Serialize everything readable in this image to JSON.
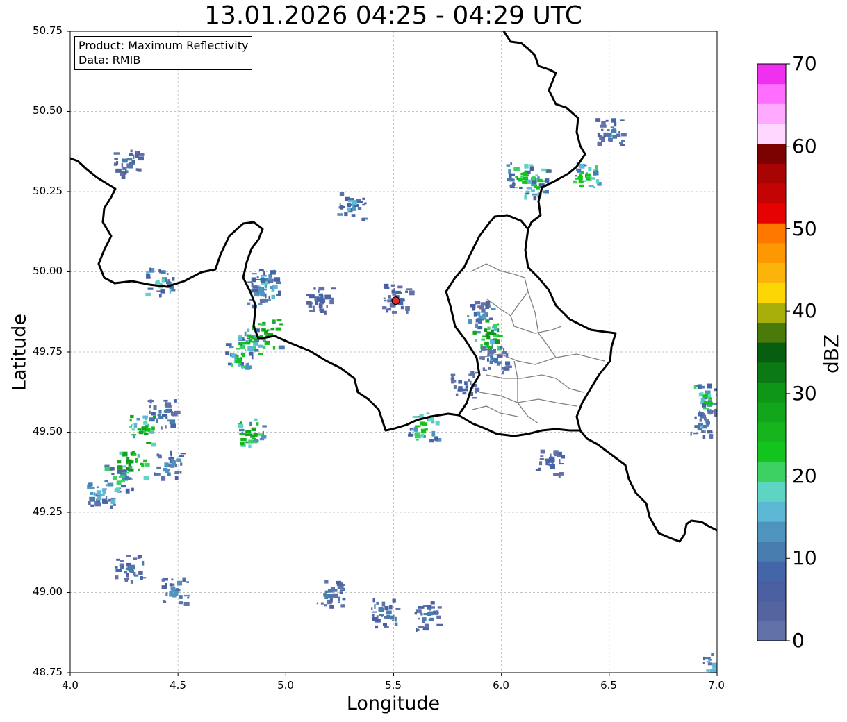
{
  "title": "13.01.2026 04:25 - 04:29 UTC",
  "info_box": {
    "product": "Product: Maximum Reflectivity",
    "data": "Data: RMIB"
  },
  "chart_data": {
    "type": "heatmap",
    "title": "13.01.2026 04:25 - 04:29 UTC",
    "xlabel": "Longitude",
    "ylabel": "Latitude",
    "xlim": [
      4.0,
      7.0
    ],
    "ylim": [
      48.75,
      50.75
    ],
    "x_ticks": [
      "4.0",
      "4.5",
      "5.0",
      "5.5",
      "6.0",
      "6.5",
      "7.0"
    ],
    "y_ticks": [
      "48.75",
      "49.00",
      "49.25",
      "49.50",
      "49.75",
      "50.00",
      "50.25",
      "50.50",
      "50.75"
    ],
    "grid": true,
    "radar_site": {
      "lon": 5.51,
      "lat": 49.91
    },
    "colorbar": {
      "label": "dBZ",
      "min": 0,
      "max": 70,
      "ticks": [
        "0",
        "10",
        "20",
        "30",
        "40",
        "50",
        "60",
        "70"
      ],
      "colors": [
        "#6272a8",
        "#53649e",
        "#4a5ea0",
        "#4466a8",
        "#477caf",
        "#4f94bf",
        "#5db8d6",
        "#5ed5c2",
        "#3dd164",
        "#13c41c",
        "#16b51d",
        "#11a51b",
        "#0e9617",
        "#0b7a14",
        "#085e10",
        "#4a7a0a",
        "#a8ae0a",
        "#fdd705",
        "#fdb40a",
        "#fd9803",
        "#fe7800",
        "#e60202",
        "#c40404",
        "#a80404",
        "#7c0202",
        "#ffd6ff",
        "#ffa8ff",
        "#ff6eff",
        "#f030f0"
      ]
    },
    "echo_cells": [
      {
        "lon": 4.28,
        "lat": 49.4,
        "dbz": 30
      },
      {
        "lon": 4.22,
        "lat": 49.36,
        "dbz": 20
      },
      {
        "lon": 4.33,
        "lat": 49.51,
        "dbz": 28
      },
      {
        "lon": 4.14,
        "lat": 49.31,
        "dbz": 15
      },
      {
        "lon": 4.45,
        "lat": 49.4,
        "dbz": 14
      },
      {
        "lon": 4.42,
        "lat": 49.56,
        "dbz": 12
      },
      {
        "lon": 4.83,
        "lat": 49.5,
        "dbz": 28
      },
      {
        "lon": 4.91,
        "lat": 49.81,
        "dbz": 28
      },
      {
        "lon": 4.83,
        "lat": 49.79,
        "dbz": 25
      },
      {
        "lon": 4.78,
        "lat": 49.74,
        "dbz": 22
      },
      {
        "lon": 4.9,
        "lat": 49.97,
        "dbz": 18
      },
      {
        "lon": 4.87,
        "lat": 49.94,
        "dbz": 14
      },
      {
        "lon": 4.41,
        "lat": 49.97,
        "dbz": 18
      },
      {
        "lon": 4.26,
        "lat": 50.34,
        "dbz": 10
      },
      {
        "lon": 5.15,
        "lat": 49.92,
        "dbz": 8
      },
      {
        "lon": 5.51,
        "lat": 49.92,
        "dbz": 8
      },
      {
        "lon": 5.9,
        "lat": 49.87,
        "dbz": 14
      },
      {
        "lon": 5.93,
        "lat": 49.81,
        "dbz": 30
      },
      {
        "lon": 5.96,
        "lat": 49.73,
        "dbz": 10
      },
      {
        "lon": 5.82,
        "lat": 49.65,
        "dbz": 8
      },
      {
        "lon": 5.63,
        "lat": 49.52,
        "dbz": 22
      },
      {
        "lon": 6.5,
        "lat": 50.44,
        "dbz": 10
      },
      {
        "lon": 6.15,
        "lat": 50.28,
        "dbz": 22
      },
      {
        "lon": 6.38,
        "lat": 50.3,
        "dbz": 24
      },
      {
        "lon": 6.93,
        "lat": 49.53,
        "dbz": 10
      },
      {
        "lon": 6.95,
        "lat": 49.61,
        "dbz": 22
      },
      {
        "lon": 6.22,
        "lat": 49.41,
        "dbz": 8
      },
      {
        "lon": 4.27,
        "lat": 49.08,
        "dbz": 12
      },
      {
        "lon": 4.48,
        "lat": 49.01,
        "dbz": 14
      },
      {
        "lon": 5.2,
        "lat": 49.0,
        "dbz": 12
      },
      {
        "lon": 5.45,
        "lat": 48.94,
        "dbz": 12
      },
      {
        "lon": 5.65,
        "lat": 48.93,
        "dbz": 10
      },
      {
        "lon": 6.98,
        "lat": 48.77,
        "dbz": 16
      },
      {
        "lon": 5.3,
        "lat": 50.21,
        "dbz": 16
      },
      {
        "lon": 6.08,
        "lat": 50.3,
        "dbz": 22
      }
    ]
  }
}
